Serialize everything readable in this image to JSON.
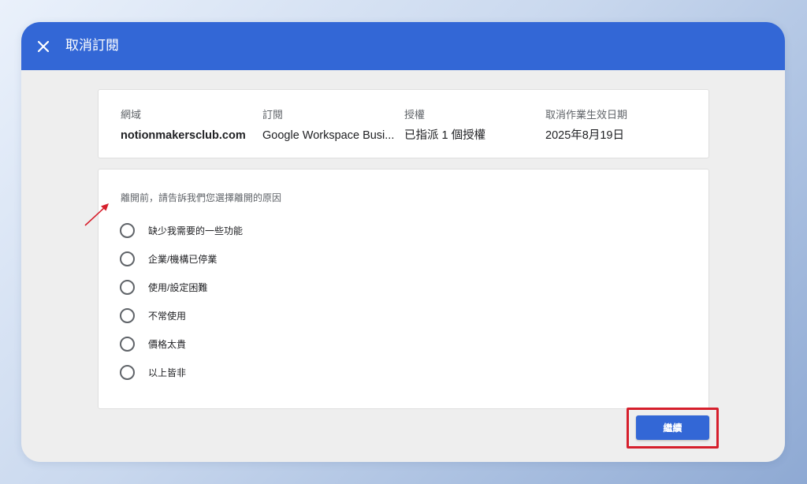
{
  "header": {
    "title": "取消訂閱",
    "close_icon": "close-icon"
  },
  "subscription_info": {
    "domain": {
      "label": "網域",
      "value": "notionmakersclub.com"
    },
    "subscription": {
      "label": "訂閱",
      "value": "Google Workspace Busi..."
    },
    "license": {
      "label": "授權",
      "value": "已指派 1 個授權"
    },
    "cancel_date": {
      "label": "取消作業生效日期",
      "value": "2025年8月19日"
    }
  },
  "reasons": {
    "prompt": "離開前，請告訴我們您選擇離開的原因",
    "options": [
      {
        "label": "缺少我需要的一些功能",
        "selected": false
      },
      {
        "label": "企業/機構已停業",
        "selected": false
      },
      {
        "label": "使用/設定困難",
        "selected": false
      },
      {
        "label": "不常使用",
        "selected": false
      },
      {
        "label": "價格太貴",
        "selected": false
      },
      {
        "label": "以上皆非",
        "selected": false
      }
    ]
  },
  "actions": {
    "continue_label": "繼續"
  },
  "annotations": {
    "arrow_color": "#d61f2c",
    "highlight_color": "#d61f2c"
  },
  "colors": {
    "brand_blue": "#3367d6"
  }
}
